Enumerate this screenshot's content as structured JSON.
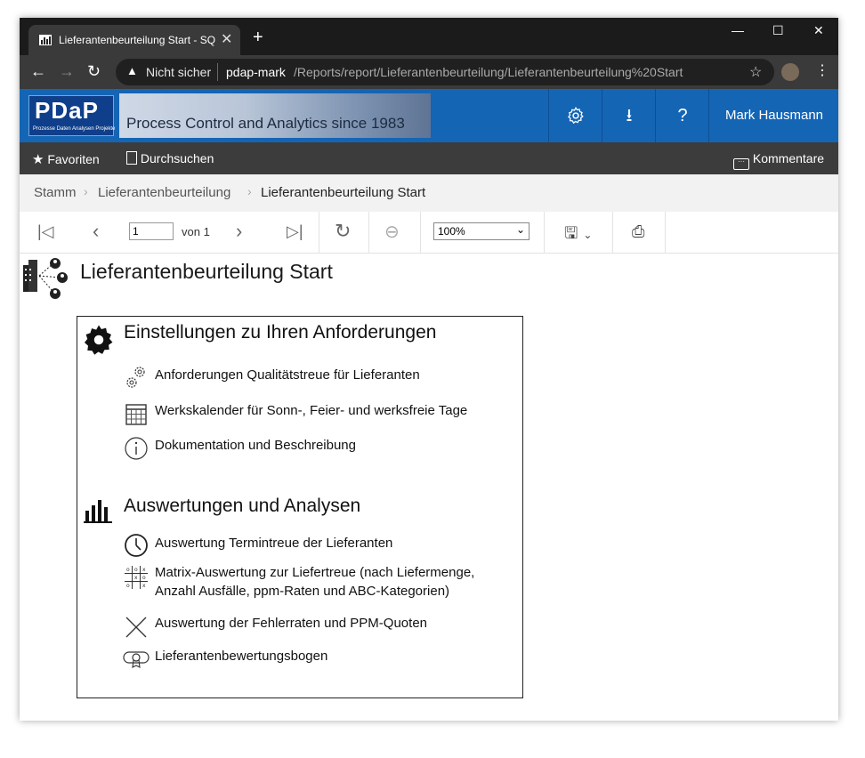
{
  "browser": {
    "tab_title": "Lieferantenbeurteilung Start - SQ",
    "not_secure": "Nicht sicher",
    "url_host": "pdap-mark",
    "url_path": "/Reports/report/Lieferantenbeurteilung/Lieferantenbeurteilung%20Start"
  },
  "header": {
    "logo_text": "PDaP",
    "logo_sub": "Prozesse Daten Analysen Projekte",
    "banner_text": "Process Control and Analytics since 1983",
    "user_name": "Mark Hausmann"
  },
  "toolbar": {
    "favorites": "Favoriten",
    "browse": "Durchsuchen",
    "comments": "Kommentare"
  },
  "breadcrumb": [
    "Stamm",
    "Lieferantenbeurteilung",
    "Lieferantenbeurteilung Start"
  ],
  "viewer": {
    "page_value": "1",
    "page_of": "von 1",
    "zoom_value": "100%"
  },
  "report": {
    "title": "Lieferantenbeurteilung Start",
    "settings": {
      "heading": "Einstellungen zu Ihren Anforderungen",
      "items": [
        "Anforderungen Qualitätstreue für Lieferanten",
        "Werkskalender für Sonn-, Feier- und werksfreie Tage",
        "Dokumentation und Beschreibung"
      ]
    },
    "analysis": {
      "heading": "Auswertungen und Analysen",
      "items": [
        "Auswertung Termintreue der Lieferanten",
        "Matrix-Auswertung zur Liefertreue (nach Liefermenge, Anzahl Ausfälle, ppm-Raten und ABC-Kategorien)",
        "Auswertung der Fehlerraten und PPM-Quoten",
        "Lieferantenbewertungsbogen"
      ]
    }
  }
}
